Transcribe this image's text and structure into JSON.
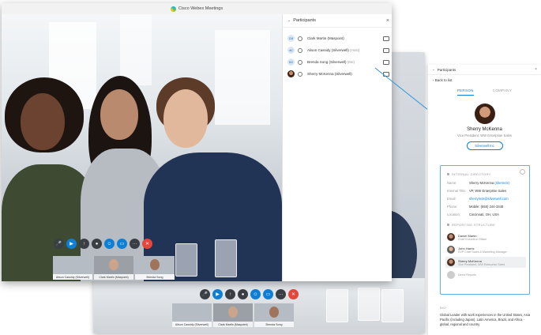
{
  "window": {
    "title": "Cisco Webex Meetings"
  },
  "participants_panel": {
    "header": "Participants",
    "items": [
      {
        "initials": "CM",
        "name": "Clark Martin (Maspoint)",
        "site": "",
        "photo": false
      },
      {
        "initials": "AC",
        "name": "Alison Cassidy (Silverwell)",
        "site": "(Host)",
        "photo": false
      },
      {
        "initials": "BS",
        "name": "Brenda Song (Silverwell)",
        "site": "(Me)",
        "photo": false
      },
      {
        "initials": "",
        "name": "Sherry McKenna (Silverwell)",
        "site": "",
        "photo": true
      }
    ]
  },
  "thumbnails_main": [
    {
      "label": "Alison Cassidy (Silverwell)"
    },
    {
      "label": "Clark Martin (Maspoint)"
    },
    {
      "label": "Brenda Song"
    }
  ],
  "thumbnails_bg": [
    {
      "label": "Alison Cassidy (Silverwell)"
    },
    {
      "label": "Clark Martin (Maspoint)"
    },
    {
      "label": "Brenda Song"
    }
  ],
  "controls": {
    "mic_icon": "mic-icon",
    "video_icon": "video-icon",
    "share_icon": "share-icon",
    "record_icon": "record-icon",
    "participants_icon": "participants-icon",
    "chat_icon": "chat-icon",
    "more_label": "···",
    "leave_label": "✕"
  },
  "profile": {
    "header": "Participants",
    "back_label": "Back to list",
    "tabs": {
      "person": "PERSON",
      "company": "COMPANY"
    },
    "name": "Sherry McKenna",
    "title": "Vice President, WW Enterprise Sales",
    "company": "Silverwell Inc",
    "directory_title": "INTERNAL DIRECTORY",
    "directory": [
      {
        "key": "Name:",
        "value": "Sherry McKenna",
        "extra": "(shermck)"
      },
      {
        "key": "Internal Title:",
        "value": "VP, WW Enterprise Sales",
        "extra": ""
      },
      {
        "key": "Email:",
        "value": "sherrymck@silverwell.com",
        "extra": ""
      },
      {
        "key": "Phone:",
        "value": "Mobile: (650) 244-3348",
        "extra": ""
      },
      {
        "key": "Location:",
        "value": "Cincinnati, OH, USA",
        "extra": ""
      }
    ],
    "reporting_title": "REPORTING STRUCTURE",
    "reporting": [
      {
        "name": "Daniel Martin",
        "role": "Chief Executive Officer",
        "selected": false
      },
      {
        "name": "John Harris",
        "role": "SVP Chief Sales & Marketing Manager",
        "selected": false
      },
      {
        "name": "Sherry McKenna",
        "role": "Vice President, WW Enterprise Sales",
        "selected": true
      },
      {
        "name": "Direct Reports",
        "role": "",
        "selected": false
      }
    ],
    "bio_title": "BIO",
    "bio": "Global Leader with work experiences in the United States, Asia Pacific (including Japan), Latin America, Brazil, and Africa - global, regional and country"
  },
  "colors": {
    "accent": "#0d7fd6",
    "leave": "#e8453c",
    "link_border": "#5fb0e8"
  }
}
